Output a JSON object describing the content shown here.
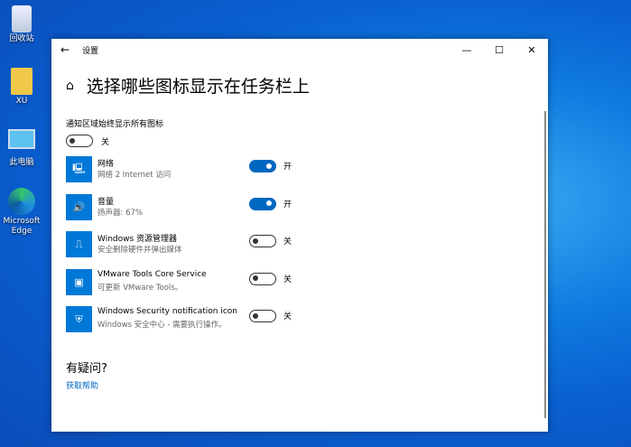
{
  "desktop": [
    {
      "label": "回收站",
      "icon": "recycle-bin-icon"
    },
    {
      "label": "XU",
      "icon": "user-folder-icon"
    },
    {
      "label": "此电脑",
      "icon": "computer-icon"
    },
    {
      "label": "Microsoft Edge",
      "icon": "edge-icon"
    }
  ],
  "window": {
    "title": "设置",
    "heading": "选择哪些图标显示在任务栏上",
    "always_label": "通知区域始终显示所有图标",
    "always_state": "关",
    "items": [
      {
        "name": "网络",
        "sub": "网络 2 Internet 访问",
        "state": "开",
        "on": true,
        "icon": "network-icon"
      },
      {
        "name": "音量",
        "sub": "扬声器: 67%",
        "state": "开",
        "on": true,
        "icon": "volume-icon"
      },
      {
        "name": "Windows 资源管理器",
        "sub": "安全删除硬件并弹出媒体",
        "state": "关",
        "on": false,
        "icon": "usb-icon"
      },
      {
        "name": "VMware Tools Core Service",
        "sub": "可更新 VMware Tools。",
        "state": "关",
        "on": false,
        "icon": "vmware-icon"
      },
      {
        "name": "Windows Security notification icon",
        "sub": "Windows 安全中心 - 需要执行操作。",
        "state": "关",
        "on": false,
        "icon": "shield-icon"
      }
    ],
    "help_heading": "有疑问?",
    "help_link": "获取帮助"
  },
  "colors": {
    "accent": "#0067c0"
  }
}
